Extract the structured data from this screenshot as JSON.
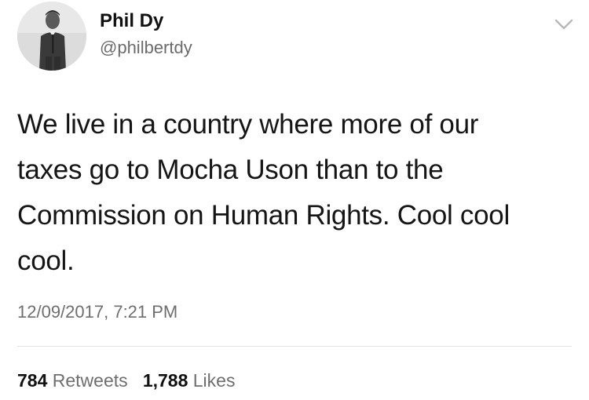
{
  "user": {
    "display_name": "Phil Dy",
    "handle": "@philbertdy"
  },
  "tweet": {
    "lines": [
      "We live in a country where more of our",
      "taxes go to Mocha Uson than to the",
      "Commission on Human Rights. Cool cool",
      "cool."
    ],
    "timestamp": "12/09/2017, 7:21 PM"
  },
  "stats": {
    "retweets_count": "784",
    "retweets_label": "Retweets",
    "likes_count": "1,788",
    "likes_label": "Likes"
  },
  "icons": {
    "menu": "chevron-down-icon"
  },
  "colors": {
    "text": "#151515",
    "secondary_text": "#6e6e6e",
    "divider": "#e2e2e2"
  }
}
